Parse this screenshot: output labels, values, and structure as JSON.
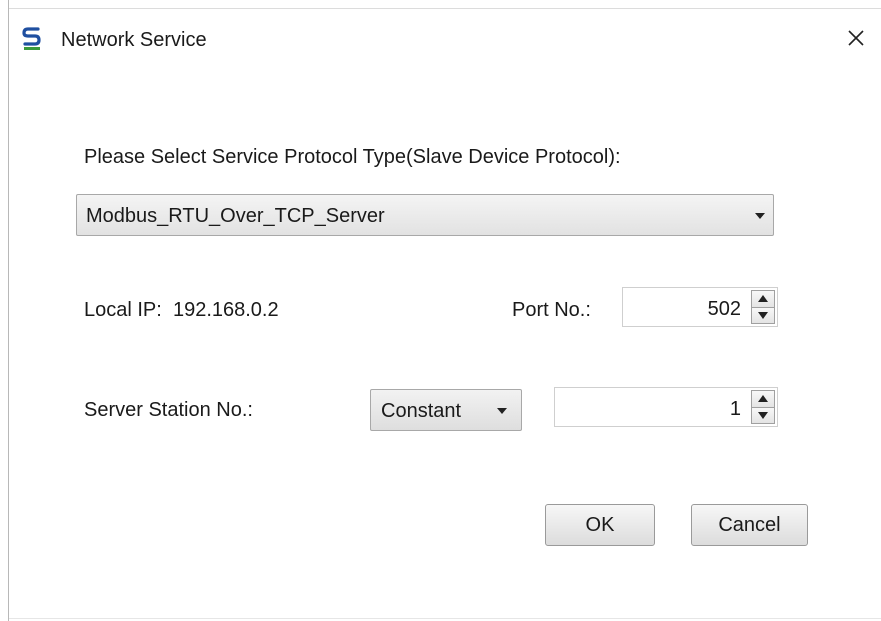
{
  "window": {
    "title": "Network Service",
    "icon": "app-logo-icon",
    "close_icon": "close-icon"
  },
  "protocol": {
    "prompt": "Please Select Service Protocol Type(Slave Device Protocol):",
    "selected": "Modbus_RTU_Over_TCP_Server"
  },
  "network": {
    "local_ip_label": "Local IP:",
    "local_ip_value": "192.168.0.2",
    "port_label": "Port No.:",
    "port_value": "502"
  },
  "station": {
    "label": "Server Station No.:",
    "mode": "Constant",
    "value": "1"
  },
  "buttons": {
    "ok": "OK",
    "cancel": "Cancel"
  },
  "colors": {
    "logo_blue": "#1f4fa0",
    "logo_green": "#3a9a3a"
  }
}
